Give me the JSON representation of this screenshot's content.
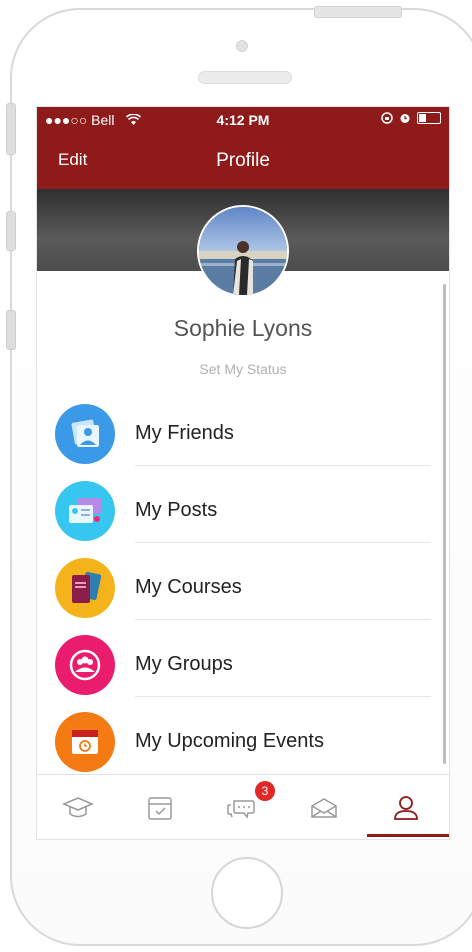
{
  "status_bar": {
    "carrier": "●●●○○ Bell",
    "time": "4:12 PM"
  },
  "nav": {
    "edit_label": "Edit",
    "title": "Profile"
  },
  "profile": {
    "name": "Sophie Lyons",
    "status_link": "Set My Status"
  },
  "menu": [
    {
      "label": "My Friends",
      "icon": "friends-icon",
      "color": "#3a9ae8"
    },
    {
      "label": "My Posts",
      "icon": "posts-icon",
      "color": "#36c6f0"
    },
    {
      "label": "My Courses",
      "icon": "courses-icon",
      "color": "#f5b31b"
    },
    {
      "label": "My Groups",
      "icon": "groups-icon",
      "color": "#ea1c6e"
    },
    {
      "label": "My Upcoming Events",
      "icon": "events-icon",
      "color": "#f47a13"
    }
  ],
  "tabbar": {
    "items": [
      "courses-tab",
      "tasks-tab",
      "messages-tab",
      "mail-tab",
      "profile-tab"
    ],
    "messages_badge": "3",
    "active": "profile-tab"
  },
  "colors": {
    "brand": "#8e1a1a",
    "tab_icon": "#9a9a9a",
    "active_tab_icon": "#8e1a1a"
  }
}
